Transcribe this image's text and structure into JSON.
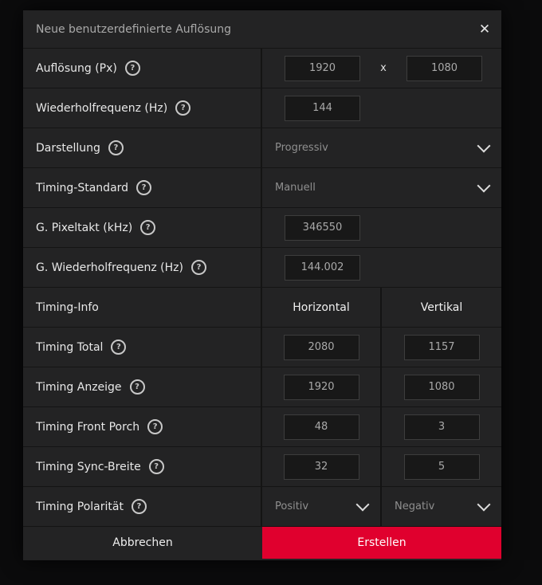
{
  "dialog": {
    "title": "Neue benutzerdefinierte Auflösung",
    "close_icon": "close-icon"
  },
  "rows": {
    "resolution": {
      "label": "Auflösung (Px)",
      "width": "1920",
      "separator": "x",
      "height": "1080"
    },
    "refresh": {
      "label": "Wiederholfrequenz (Hz)",
      "value": "144"
    },
    "display": {
      "label": "Darstellung",
      "selected": "Progressiv"
    },
    "timing_standard": {
      "label": "Timing-Standard",
      "selected": "Manuell"
    },
    "pixel_clock": {
      "label": "G. Pixeltakt (kHz)",
      "value": "346550"
    },
    "refresh_result": {
      "label": "G. Wiederholfrequenz (Hz)",
      "value": "144.002"
    },
    "timing_info": {
      "label": "Timing-Info",
      "horizontal": "Horizontal",
      "vertical": "Vertikal"
    },
    "timing_total": {
      "label": "Timing Total",
      "h": "2080",
      "v": "1157"
    },
    "timing_display": {
      "label": "Timing Anzeige",
      "h": "1920",
      "v": "1080"
    },
    "timing_front_porch": {
      "label": "Timing Front Porch",
      "h": "48",
      "v": "3"
    },
    "timing_sync_width": {
      "label": "Timing Sync-Breite",
      "h": "32",
      "v": "5"
    },
    "timing_polarity": {
      "label": "Timing Polarität",
      "h": "Positiv",
      "v": "Negativ"
    }
  },
  "footer": {
    "cancel_label": "Abbrechen",
    "create_label": "Erstellen"
  },
  "colors": {
    "accent": "#e0002e",
    "background": "#232324"
  }
}
